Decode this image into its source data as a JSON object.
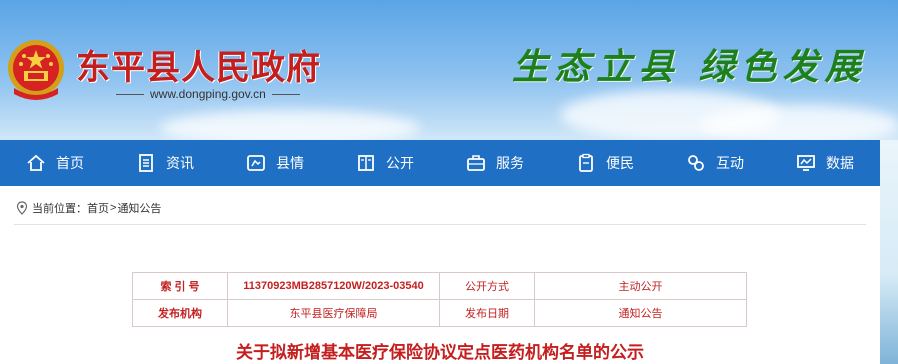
{
  "header": {
    "site_title": "东平县人民政府",
    "site_url": "www.dongping.gov.cn",
    "slogan": "生态立县  绿色发展"
  },
  "nav": {
    "items": [
      {
        "label": "首页",
        "icon": "home-icon"
      },
      {
        "label": "资讯",
        "icon": "news-icon"
      },
      {
        "label": "县情",
        "icon": "county-icon"
      },
      {
        "label": "公开",
        "icon": "open-book-icon"
      },
      {
        "label": "服务",
        "icon": "briefcase-icon"
      },
      {
        "label": "便民",
        "icon": "clipboard-icon"
      },
      {
        "label": "互动",
        "icon": "interact-icon"
      },
      {
        "label": "数据",
        "icon": "chart-icon"
      }
    ],
    "bg_color": "#1f6fc4"
  },
  "breadcrumb": {
    "prefix": "当前位置：",
    "home": "首页",
    "separator": ">",
    "current": "通知公告"
  },
  "meta": {
    "index_label": "索 引 号",
    "index_value": "11370923MB2857120W/2023-03540",
    "disclosure_label": "公开方式",
    "disclosure_value": "主动公开",
    "publisher_label": "发布机构",
    "publisher_value": "东平县医疗保障局",
    "date_label": "发布日期",
    "category_value": "通知公告"
  },
  "article": {
    "title": "关于拟新增基本医疗保险协议定点医药机构名单的公示"
  },
  "colors": {
    "title_red": "#c41e1e",
    "slogan_green": "#1e7f1e"
  }
}
